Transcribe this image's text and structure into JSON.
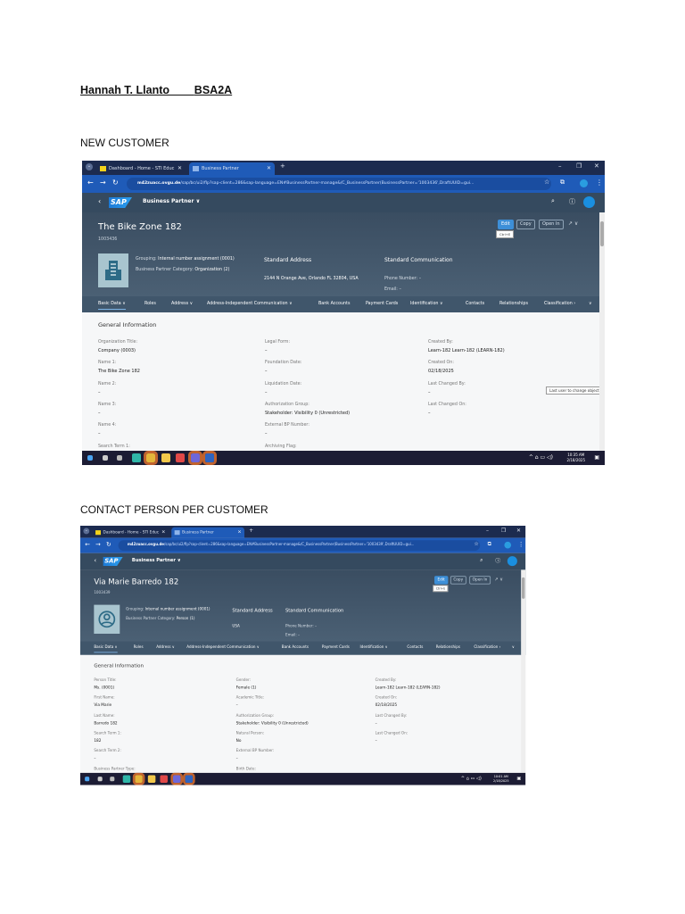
{
  "document": {
    "student_name": "Hannah T. Llanto",
    "section": "BSA2A",
    "heading_1": "NEW CUSTOMER",
    "heading_2": "CONTACT PERSON PER CUSTOMER"
  },
  "screens": [
    {
      "tab_1": "Dashboard - Home - STI Educ",
      "tab_2": "Business Partner",
      "url_domain": "m42zuacc.ovgu.de",
      "url_path": "/sap/bc/ui2/flp?sap-client=286&sap-language=EN#BusinessPartner-manage&/C_BusinessPartner(BusinessPartner='1003436',DraftUUID=gui...",
      "app_title": "Business Partner",
      "title": "The Bike Zone 182",
      "bp_id": "1003436",
      "avatar_icon": "building-icon",
      "grouping_label": "Grouping:",
      "grouping_value": "Internal number assignment (0001)",
      "category_label": "Business Partner Category:",
      "category_value": "Organization (2)",
      "std_address_heading": "Standard Address",
      "std_address_value": "2144 N Orange Ave, Orlando FL 32804, USA",
      "std_comm_heading": "Standard Communication",
      "phone": "Phone Number: –",
      "email": "Email: –",
      "btn_edit": "Edit",
      "btn_copy": "Copy",
      "btn_open": "Open In",
      "edit_tooltip": "Ctrl+E",
      "field_tooltip": "Last user to change object",
      "nav": [
        "Basic Data ∨",
        "Roles",
        "Address ∨",
        "Address-Independent Communication ∨",
        "Bank Accounts",
        "Payment Cards",
        "Identification ∨",
        "Contacts",
        "Relationships",
        "Classification ›"
      ],
      "section": "General Information",
      "columns": [
        [
          [
            "Organization Title:",
            "Company (0003)"
          ],
          [
            "Name 1:",
            "The Bike Zone 182"
          ],
          [
            "Name 2:",
            "–"
          ],
          [
            "Name 3:",
            "–"
          ],
          [
            "Name 4:",
            "–"
          ],
          [
            "Search Term 1:",
            ""
          ]
        ],
        [
          [
            "Legal Form:",
            "–"
          ],
          [
            "Foundation Date:",
            "–"
          ],
          [
            "Liquidation Date:",
            "–"
          ],
          [
            "Authorization Group:",
            "Stakeholder: Visibility 0 (Unrestricted)"
          ],
          [
            "External BP Number:",
            "–"
          ],
          [
            "Archiving Flag:",
            ""
          ]
        ],
        [
          [
            "Created By:",
            "Learn-182 Learn-182 (LEARN-182)"
          ],
          [
            "Created On:",
            "02/18/2025"
          ],
          [
            "Last Changed By:",
            "–"
          ],
          [
            "Last Changed On:",
            "–"
          ]
        ]
      ],
      "time": "10:35 AM",
      "date": "2/18/2025"
    },
    {
      "tab_1": "Dashboard - Home - STI Educ",
      "tab_2": "Business Partner",
      "url_domain": "m42zuacc.ovgu.de",
      "url_path": "/sap/bc/ui2/flp?sap-client=286&sap-language=EN#BusinessPartner-manage&/C_BusinessPartner(BusinessPartner='1003439',DraftUUID=gui...",
      "app_title": "Business Partner",
      "title": "Via Marie Barredo 182",
      "bp_id": "1003439",
      "avatar_icon": "person-icon",
      "grouping_label": "Grouping:",
      "grouping_value": "Internal number assignment (0001)",
      "category_label": "Business Partner Category:",
      "category_value": "Person (1)",
      "std_address_heading": "Standard Address",
      "std_address_value": "USA",
      "std_comm_heading": "Standard Communication",
      "phone": "Phone Number: –",
      "email": "Email: –",
      "btn_edit": "Edit",
      "btn_copy": "Copy",
      "btn_open": "Open In",
      "edit_tooltip": "Ctrl+E",
      "nav": [
        "Basic Data ∨",
        "Roles",
        "Address ∨",
        "Address-Independent Communication ∨",
        "Bank Accounts",
        "Payment Cards",
        "Identification ∨",
        "Contacts",
        "Relationships",
        "Classification ›"
      ],
      "section": "General Information",
      "columns": [
        [
          [
            "Person Title:",
            "Ms. (0001)"
          ],
          [
            "First Name:",
            "Via Marie"
          ],
          [
            "Last Name:",
            "Barredo 182"
          ],
          [
            "Search Term 1:",
            "182"
          ],
          [
            "Search Term 2:",
            "–"
          ],
          [
            "Business Partner Type:",
            ""
          ]
        ],
        [
          [
            "Gender:",
            "Female (1)"
          ],
          [
            "Academic Title:",
            "–"
          ],
          [
            "Authorization Group:",
            "Stakeholder: Visibility 0 (Unrestricted)"
          ],
          [
            "Natural Person:",
            "No"
          ],
          [
            "External BP Number:",
            "–"
          ],
          [
            "Birth Date:",
            ""
          ]
        ],
        [
          [
            "Created By:",
            "Learn-182 Learn-182 (LEARN-182)"
          ],
          [
            "Created On:",
            "02/18/2025"
          ],
          [
            "Last Changed By:",
            "–"
          ],
          [
            "Last Changed On:",
            "–"
          ]
        ]
      ],
      "time": "10:01 AM",
      "date": "2/18/2025"
    }
  ]
}
